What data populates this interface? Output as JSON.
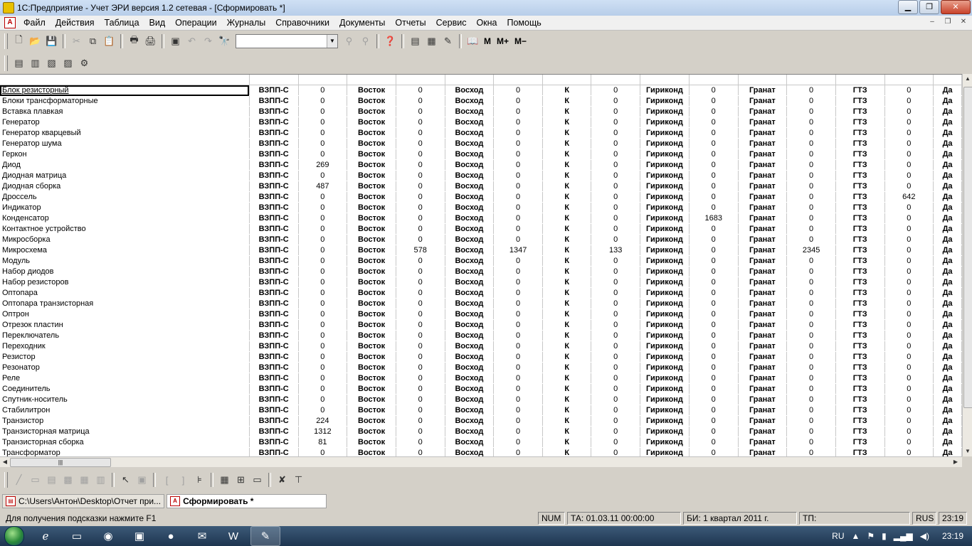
{
  "window": {
    "title": "1С:Предприятие - Учет ЭРИ версия 1.2 сетевая - [Сформировать  *]",
    "min": "▁",
    "max": "❐",
    "close": "✕"
  },
  "menu": {
    "items": [
      "Файл",
      "Действия",
      "Таблица",
      "Вид",
      "Операции",
      "Журналы",
      "Справочники",
      "Документы",
      "Отчеты",
      "Сервис",
      "Окна",
      "Помощь"
    ],
    "mdi": {
      "min": "‒",
      "restore": "❐",
      "close": "✕"
    }
  },
  "toolbar": {
    "combo_value": "",
    "mem": {
      "m": "M",
      "mplus": "M+",
      "mminus": "M−"
    }
  },
  "table": {
    "columns": [
      "supplier1",
      "qty1",
      "supplier2",
      "qty2",
      "supplier3",
      "qty3",
      "supplier4",
      "qty4",
      "supplier5",
      "qty5",
      "supplier6",
      "qty6",
      "supplier7",
      "qty7",
      "supplier8"
    ],
    "rows": [
      [
        "Блок резисторный",
        "ВЗПП-С",
        "0",
        "Восток",
        "0",
        "Восход",
        "0",
        "К",
        "0",
        "Гириконд",
        "0",
        "Гранат",
        "0",
        "ГТЗ",
        "0",
        "Да"
      ],
      [
        "Блоки трансформаторные",
        "ВЗПП-С",
        "0",
        "Восток",
        "0",
        "Восход",
        "0",
        "К",
        "0",
        "Гириконд",
        "0",
        "Гранат",
        "0",
        "ГТЗ",
        "0",
        "Да"
      ],
      [
        "Вставка плавкая",
        "ВЗПП-С",
        "0",
        "Восток",
        "0",
        "Восход",
        "0",
        "К",
        "0",
        "Гириконд",
        "0",
        "Гранат",
        "0",
        "ГТЗ",
        "0",
        "Да"
      ],
      [
        "Генератор",
        "ВЗПП-С",
        "0",
        "Восток",
        "0",
        "Восход",
        "0",
        "К",
        "0",
        "Гириконд",
        "0",
        "Гранат",
        "0",
        "ГТЗ",
        "0",
        "Да"
      ],
      [
        "Генератор кварцевый",
        "ВЗПП-С",
        "0",
        "Восток",
        "0",
        "Восход",
        "0",
        "К",
        "0",
        "Гириконд",
        "0",
        "Гранат",
        "0",
        "ГТЗ",
        "0",
        "Да"
      ],
      [
        "Генератор шума",
        "ВЗПП-С",
        "0",
        "Восток",
        "0",
        "Восход",
        "0",
        "К",
        "0",
        "Гириконд",
        "0",
        "Гранат",
        "0",
        "ГТЗ",
        "0",
        "Да"
      ],
      [
        "Геркон",
        "ВЗПП-С",
        "0",
        "Восток",
        "0",
        "Восход",
        "0",
        "К",
        "0",
        "Гириконд",
        "0",
        "Гранат",
        "0",
        "ГТЗ",
        "0",
        "Да"
      ],
      [
        "Диод",
        "ВЗПП-С",
        "269",
        "Восток",
        "0",
        "Восход",
        "0",
        "К",
        "0",
        "Гириконд",
        "0",
        "Гранат",
        "0",
        "ГТЗ",
        "0",
        "Да"
      ],
      [
        "Диодная матрица",
        "ВЗПП-С",
        "0",
        "Восток",
        "0",
        "Восход",
        "0",
        "К",
        "0",
        "Гириконд",
        "0",
        "Гранат",
        "0",
        "ГТЗ",
        "0",
        "Да"
      ],
      [
        "Диодная сборка",
        "ВЗПП-С",
        "487",
        "Восток",
        "0",
        "Восход",
        "0",
        "К",
        "0",
        "Гириконд",
        "0",
        "Гранат",
        "0",
        "ГТЗ",
        "0",
        "Да"
      ],
      [
        "Дроссель",
        "ВЗПП-С",
        "0",
        "Восток",
        "0",
        "Восход",
        "0",
        "К",
        "0",
        "Гириконд",
        "0",
        "Гранат",
        "0",
        "ГТЗ",
        "642",
        "Да"
      ],
      [
        "Индикатор",
        "ВЗПП-С",
        "0",
        "Восток",
        "0",
        "Восход",
        "0",
        "К",
        "0",
        "Гириконд",
        "0",
        "Гранат",
        "0",
        "ГТЗ",
        "0",
        "Да"
      ],
      [
        "Конденсатор",
        "ВЗПП-С",
        "0",
        "Восток",
        "0",
        "Восход",
        "0",
        "К",
        "0",
        "Гириконд",
        "1683",
        "Гранат",
        "0",
        "ГТЗ",
        "0",
        "Да"
      ],
      [
        "Контактное устройство",
        "ВЗПП-С",
        "0",
        "Восток",
        "0",
        "Восход",
        "0",
        "К",
        "0",
        "Гириконд",
        "0",
        "Гранат",
        "0",
        "ГТЗ",
        "0",
        "Да"
      ],
      [
        "Микросборка",
        "ВЗПП-С",
        "0",
        "Восток",
        "0",
        "Восход",
        "0",
        "К",
        "0",
        "Гириконд",
        "0",
        "Гранат",
        "0",
        "ГТЗ",
        "0",
        "Да"
      ],
      [
        "Микросхема",
        "ВЗПП-С",
        "0",
        "Восток",
        "578",
        "Восход",
        "1347",
        "К",
        "133",
        "Гириконд",
        "0",
        "Гранат",
        "2345",
        "ГТЗ",
        "0",
        "Да"
      ],
      [
        "Модуль",
        "ВЗПП-С",
        "0",
        "Восток",
        "0",
        "Восход",
        "0",
        "К",
        "0",
        "Гириконд",
        "0",
        "Гранат",
        "0",
        "ГТЗ",
        "0",
        "Да"
      ],
      [
        "Набор диодов",
        "ВЗПП-С",
        "0",
        "Восток",
        "0",
        "Восход",
        "0",
        "К",
        "0",
        "Гириконд",
        "0",
        "Гранат",
        "0",
        "ГТЗ",
        "0",
        "Да"
      ],
      [
        "Набор резисторов",
        "ВЗПП-С",
        "0",
        "Восток",
        "0",
        "Восход",
        "0",
        "К",
        "0",
        "Гириконд",
        "0",
        "Гранат",
        "0",
        "ГТЗ",
        "0",
        "Да"
      ],
      [
        "Оптопара",
        "ВЗПП-С",
        "0",
        "Восток",
        "0",
        "Восход",
        "0",
        "К",
        "0",
        "Гириконд",
        "0",
        "Гранат",
        "0",
        "ГТЗ",
        "0",
        "Да"
      ],
      [
        "Оптопара транзисторная",
        "ВЗПП-С",
        "0",
        "Восток",
        "0",
        "Восход",
        "0",
        "К",
        "0",
        "Гириконд",
        "0",
        "Гранат",
        "0",
        "ГТЗ",
        "0",
        "Да"
      ],
      [
        "Оптрон",
        "ВЗПП-С",
        "0",
        "Восток",
        "0",
        "Восход",
        "0",
        "К",
        "0",
        "Гириконд",
        "0",
        "Гранат",
        "0",
        "ГТЗ",
        "0",
        "Да"
      ],
      [
        "Отрезок пластин",
        "ВЗПП-С",
        "0",
        "Восток",
        "0",
        "Восход",
        "0",
        "К",
        "0",
        "Гириконд",
        "0",
        "Гранат",
        "0",
        "ГТЗ",
        "0",
        "Да"
      ],
      [
        "Переключатель",
        "ВЗПП-С",
        "0",
        "Восток",
        "0",
        "Восход",
        "0",
        "К",
        "0",
        "Гириконд",
        "0",
        "Гранат",
        "0",
        "ГТЗ",
        "0",
        "Да"
      ],
      [
        "Переходник",
        "ВЗПП-С",
        "0",
        "Восток",
        "0",
        "Восход",
        "0",
        "К",
        "0",
        "Гириконд",
        "0",
        "Гранат",
        "0",
        "ГТЗ",
        "0",
        "Да"
      ],
      [
        "Резистор",
        "ВЗПП-С",
        "0",
        "Восток",
        "0",
        "Восход",
        "0",
        "К",
        "0",
        "Гириконд",
        "0",
        "Гранат",
        "0",
        "ГТЗ",
        "0",
        "Да"
      ],
      [
        "Резонатор",
        "ВЗПП-С",
        "0",
        "Восток",
        "0",
        "Восход",
        "0",
        "К",
        "0",
        "Гириконд",
        "0",
        "Гранат",
        "0",
        "ГТЗ",
        "0",
        "Да"
      ],
      [
        "Реле",
        "ВЗПП-С",
        "0",
        "Восток",
        "0",
        "Восход",
        "0",
        "К",
        "0",
        "Гириконд",
        "0",
        "Гранат",
        "0",
        "ГТЗ",
        "0",
        "Да"
      ],
      [
        "Соединитель",
        "ВЗПП-С",
        "0",
        "Восток",
        "0",
        "Восход",
        "0",
        "К",
        "0",
        "Гириконд",
        "0",
        "Гранат",
        "0",
        "ГТЗ",
        "0",
        "Да"
      ],
      [
        "Спутник-носитель",
        "ВЗПП-С",
        "0",
        "Восток",
        "0",
        "Восход",
        "0",
        "К",
        "0",
        "Гириконд",
        "0",
        "Гранат",
        "0",
        "ГТЗ",
        "0",
        "Да"
      ],
      [
        "Стабилитрон",
        "ВЗПП-С",
        "0",
        "Восток",
        "0",
        "Восход",
        "0",
        "К",
        "0",
        "Гириконд",
        "0",
        "Гранат",
        "0",
        "ГТЗ",
        "0",
        "Да"
      ],
      [
        "Транзистор",
        "ВЗПП-С",
        "224",
        "Восток",
        "0",
        "Восход",
        "0",
        "К",
        "0",
        "Гириконд",
        "0",
        "Гранат",
        "0",
        "ГТЗ",
        "0",
        "Да"
      ],
      [
        "Транзисторная матрица",
        "ВЗПП-С",
        "1312",
        "Восток",
        "0",
        "Восход",
        "0",
        "К",
        "0",
        "Гириконд",
        "0",
        "Гранат",
        "0",
        "ГТЗ",
        "0",
        "Да"
      ],
      [
        "Транзисторная сборка",
        "ВЗПП-С",
        "81",
        "Восток",
        "0",
        "Восход",
        "0",
        "К",
        "0",
        "Гириконд",
        "0",
        "Гранат",
        "0",
        "ГТЗ",
        "0",
        "Да"
      ],
      [
        "Трансформатор",
        "ВЗПП-С",
        "0",
        "Восток",
        "0",
        "Восход",
        "0",
        "К",
        "0",
        "Гириконд",
        "0",
        "Гранат",
        "0",
        "ГТЗ",
        "0",
        "Да"
      ]
    ],
    "selected_row": 0
  },
  "tasks": {
    "file_tab": "C:\\Users\\Антон\\Desktop\\Отчет при...",
    "active_tab": "Сформировать  *"
  },
  "status": {
    "hint": "Для получения подсказки нажмите F1",
    "num": "NUM",
    "ta": "ТА: 01.03.11  00:00:00",
    "bi": "БИ: 1 квартал 2011 г.",
    "tp": "ТП:",
    "lang": "RUS",
    "time": "23:19"
  },
  "taskbar": {
    "lang": "RU",
    "clock": "23:19"
  },
  "colors": {
    "chrome": "#d4d0c8",
    "title_gradient_top": "#cfe0f4",
    "taskbar": "#1e3550"
  }
}
